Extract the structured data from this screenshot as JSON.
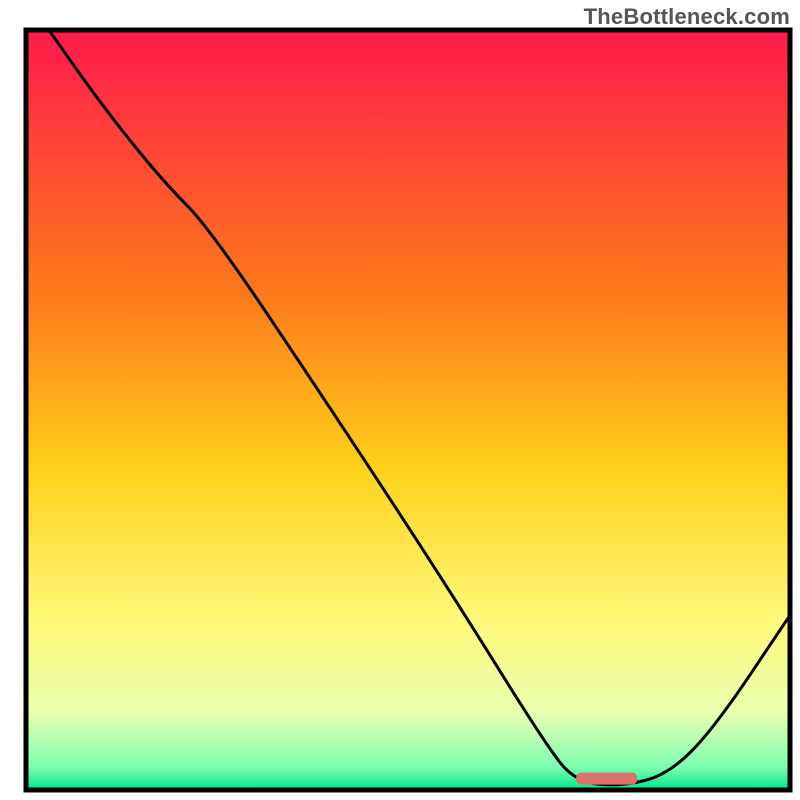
{
  "watermark": "TheBottleneck.com",
  "chart_data": {
    "type": "line",
    "title": "",
    "xlabel": "",
    "ylabel": "",
    "xlim": [
      0,
      100
    ],
    "ylim": [
      0,
      100
    ],
    "grid": false,
    "legend": false,
    "series": [
      {
        "name": "bottleneck-curve",
        "x": [
          3,
          10,
          18,
          24,
          40,
          55,
          68,
          72,
          78,
          84,
          90,
          100
        ],
        "y": [
          100,
          90,
          80,
          74,
          50,
          27,
          6,
          1,
          0.5,
          2,
          8,
          23
        ]
      }
    ],
    "marker": {
      "name": "optimal-range",
      "x_start": 72,
      "x_end": 80,
      "y": 1.5,
      "color": "#d9736b"
    },
    "background_gradient": {
      "stops": [
        {
          "offset": 0,
          "color": "#ff1a4b"
        },
        {
          "offset": 35,
          "color": "#ff7a1a"
        },
        {
          "offset": 58,
          "color": "#ffd21a"
        },
        {
          "offset": 78,
          "color": "#fff97a"
        },
        {
          "offset": 90,
          "color": "#e8ffb0"
        },
        {
          "offset": 97,
          "color": "#7cffb0"
        },
        {
          "offset": 100,
          "color": "#00e58c"
        }
      ]
    },
    "frame_color": "#000000",
    "line_color": "#000000",
    "line_width": 3
  }
}
